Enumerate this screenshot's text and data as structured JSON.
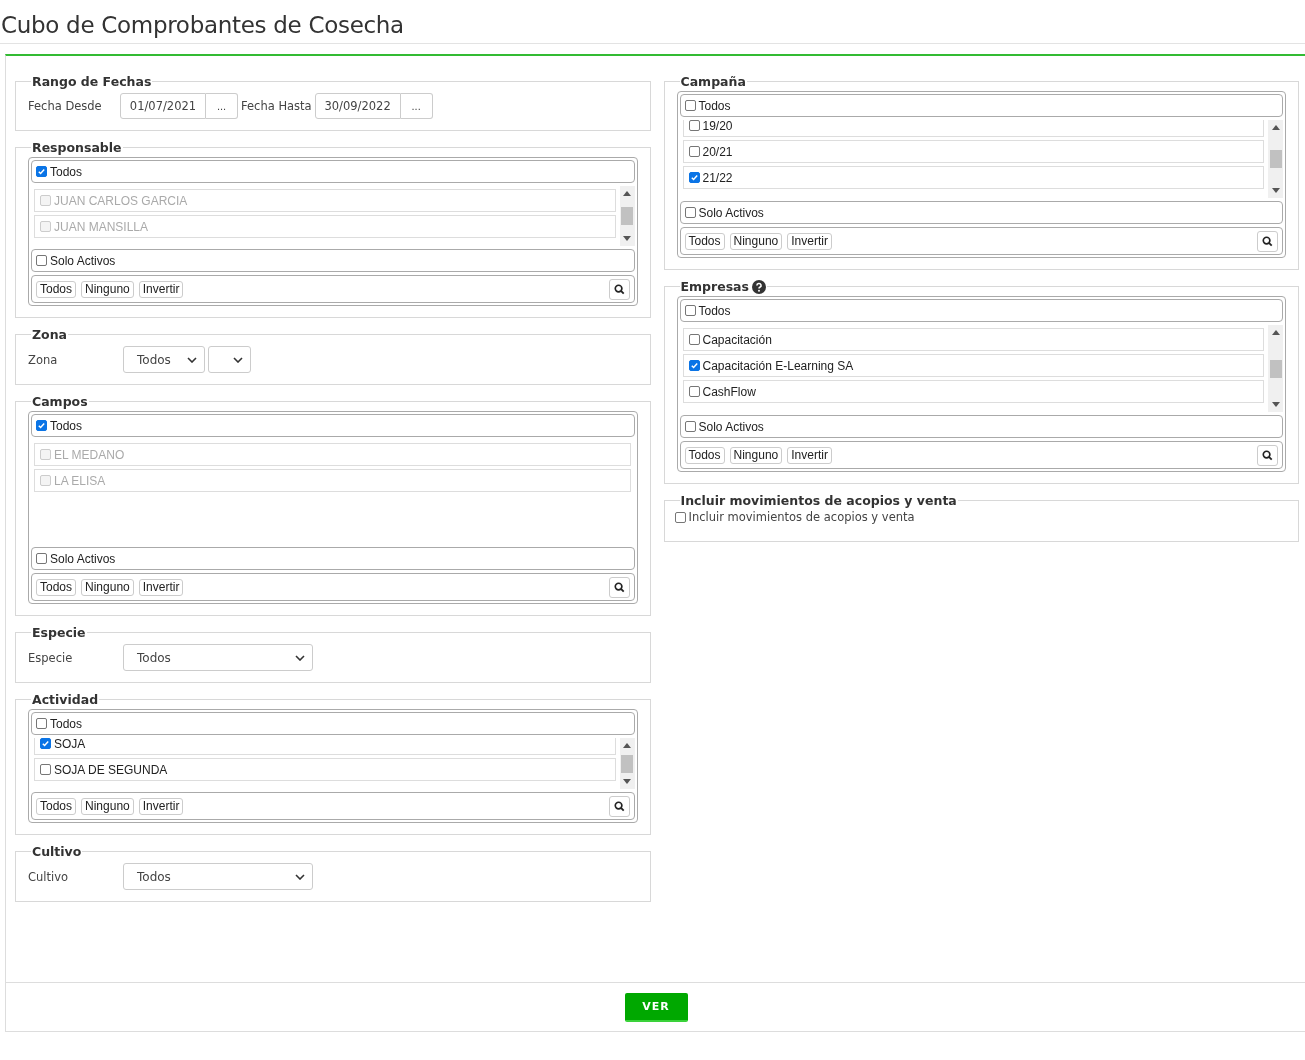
{
  "title": "Cubo de Comprobantes de Cosecha",
  "left": [
    {
      "kind": "dates",
      "legend": "Rango de Fechas",
      "fields": [
        {
          "label": "Fecha Desde",
          "value": "01/07/2021",
          "button": "..."
        },
        {
          "label": "Fecha Hasta",
          "value": "30/09/2022",
          "button": "..."
        }
      ]
    },
    {
      "kind": "multiselect",
      "legend": "Responsable",
      "scrollbar": true,
      "clipped_top": false,
      "all": {
        "label": "Todos",
        "checked": true
      },
      "items": [
        {
          "label": "JUAN CARLOS GARCIA",
          "checked": false,
          "disabled": true
        },
        {
          "label": "JUAN MANSILLA",
          "checked": false,
          "disabled": true
        }
      ],
      "active": {
        "label": "Solo Activos",
        "checked": false
      },
      "buttons": [
        "Todos",
        "Ninguno",
        "Invertir"
      ]
    },
    {
      "kind": "select",
      "legend": "Zona",
      "label": "Zona",
      "selects": [
        {
          "value": "Todos"
        },
        {
          "empty": true
        }
      ]
    },
    {
      "kind": "multiselect",
      "legend": "Campos",
      "scrollbar": false,
      "clipped_top": false,
      "all": {
        "label": "Todos",
        "checked": true
      },
      "items": [
        {
          "label": "EL MEDANO",
          "checked": false,
          "disabled": true
        },
        {
          "label": "LA ELISA",
          "checked": false,
          "disabled": true
        }
      ],
      "active": {
        "label": "Solo Activos",
        "checked": false
      },
      "buttons": [
        "Todos",
        "Ninguno",
        "Invertir"
      ]
    },
    {
      "kind": "select",
      "legend": "Especie",
      "label": "Especie",
      "selects": [
        {
          "value": "Todos"
        }
      ]
    },
    {
      "kind": "multiselect",
      "legend": "Actividad",
      "scrollbar": true,
      "clipped_top": true,
      "all": {
        "label": "Todos",
        "checked": false
      },
      "items": [
        {
          "label": "SOJA",
          "checked": true,
          "disabled": false
        },
        {
          "label": "SOJA DE SEGUNDA",
          "checked": false,
          "disabled": false
        }
      ],
      "buttons": [
        "Todos",
        "Ninguno",
        "Invertir"
      ]
    },
    {
      "kind": "select",
      "legend": "Cultivo",
      "label": "Cultivo",
      "selects": [
        {
          "value": "Todos"
        }
      ]
    }
  ],
  "right": [
    {
      "kind": "multiselect",
      "legend": "Campaña",
      "scrollbar": true,
      "clipped_top": true,
      "all": {
        "label": "Todos",
        "checked": false
      },
      "items": [
        {
          "label": "19/20",
          "checked": false,
          "disabled": false
        },
        {
          "label": "20/21",
          "checked": false,
          "disabled": false
        },
        {
          "label": "21/22",
          "checked": true,
          "disabled": false
        }
      ],
      "active": {
        "label": "Solo Activos",
        "checked": false
      },
      "buttons": [
        "Todos",
        "Ninguno",
        "Invertir"
      ]
    },
    {
      "kind": "multiselect",
      "legend": "Empresas",
      "help": true,
      "scrollbar": true,
      "clipped_top": false,
      "all": {
        "label": "Todos",
        "checked": false
      },
      "items": [
        {
          "label": "Capacitación",
          "checked": false,
          "disabled": false
        },
        {
          "label": "Capacitación E-Learning SA",
          "checked": true,
          "disabled": false
        },
        {
          "label": "CashFlow",
          "checked": false,
          "disabled": false
        }
      ],
      "active": {
        "label": "Solo Activos",
        "checked": false
      },
      "buttons": [
        "Todos",
        "Ninguno",
        "Invertir"
      ]
    },
    {
      "kind": "checkbox",
      "legend": "Incluir movimientos de acopios y venta",
      "label": "Incluir movimientos de acopios y venta",
      "checked": false
    }
  ],
  "submit": "VER"
}
